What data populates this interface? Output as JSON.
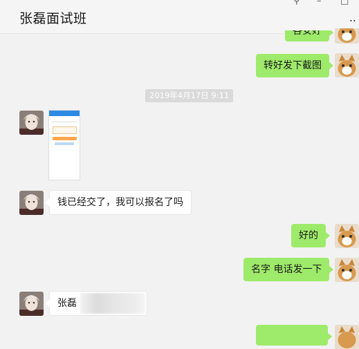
{
  "window": {
    "title": "张磊面试班",
    "controls": {
      "pin": "⚲",
      "minimize": "–",
      "close": "□"
    },
    "more_menu": ".."
  },
  "messages": {
    "sent_top_partial": "各安好",
    "sent_1": "转好发下截图",
    "timestamp": "2019年4月17日 9:11",
    "received_image_alt": "screenshot",
    "received_1": "钱已经交了，我可以报名了吗",
    "sent_2": "好的",
    "sent_3": "名字 电话发一下",
    "received_2": "张磊"
  },
  "colors": {
    "my_bubble": "#9eea6a",
    "other_bubble": "#ffffff",
    "background": "#f2f2f2"
  },
  "icons": {
    "my_avatar": "cat-avatar-icon",
    "other_avatar": "old-man-avatar-icon"
  }
}
